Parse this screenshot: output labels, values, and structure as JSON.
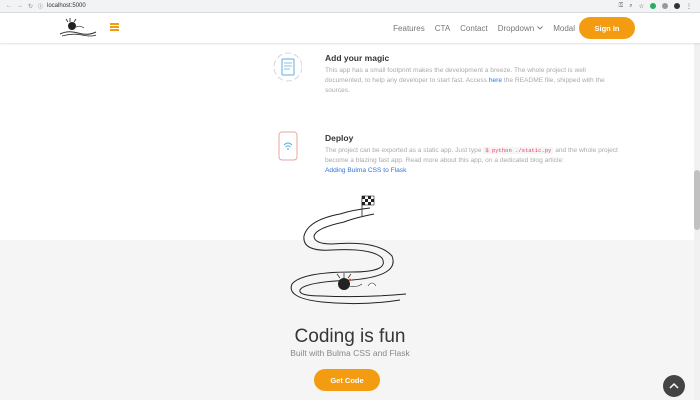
{
  "browser": {
    "url": "localhost:5000"
  },
  "navbar": {
    "items": [
      "Features",
      "CTA",
      "Contact",
      "Dropdown",
      "Modal"
    ],
    "signin": "Sign In"
  },
  "features": [
    {
      "title": "Add your magic",
      "body_pre": "This app has a small footprint makes the development a breeze. The whole project is well documented, to help any developer to start fast. Access ",
      "link": "here",
      "body_post": " the README file, shipped with the sources."
    },
    {
      "title": "Deploy",
      "body_pre": "The project can be exported as a static app. Just type ",
      "code": "$ python ./static.py",
      "body_post": " and the whole project become a blazing fast app. Read more about this app, on a dedicated blog article:",
      "link": "Adding Bulma CSS to Flask"
    }
  ],
  "hero": {
    "title": "Coding is fun",
    "subtitle": "Built with Bulma CSS and Flask",
    "button": "Get Code"
  },
  "colors": {
    "accent": "#f39c12",
    "link": "#3273dc"
  },
  "icons": {
    "totop": "arrow-up-icon"
  }
}
